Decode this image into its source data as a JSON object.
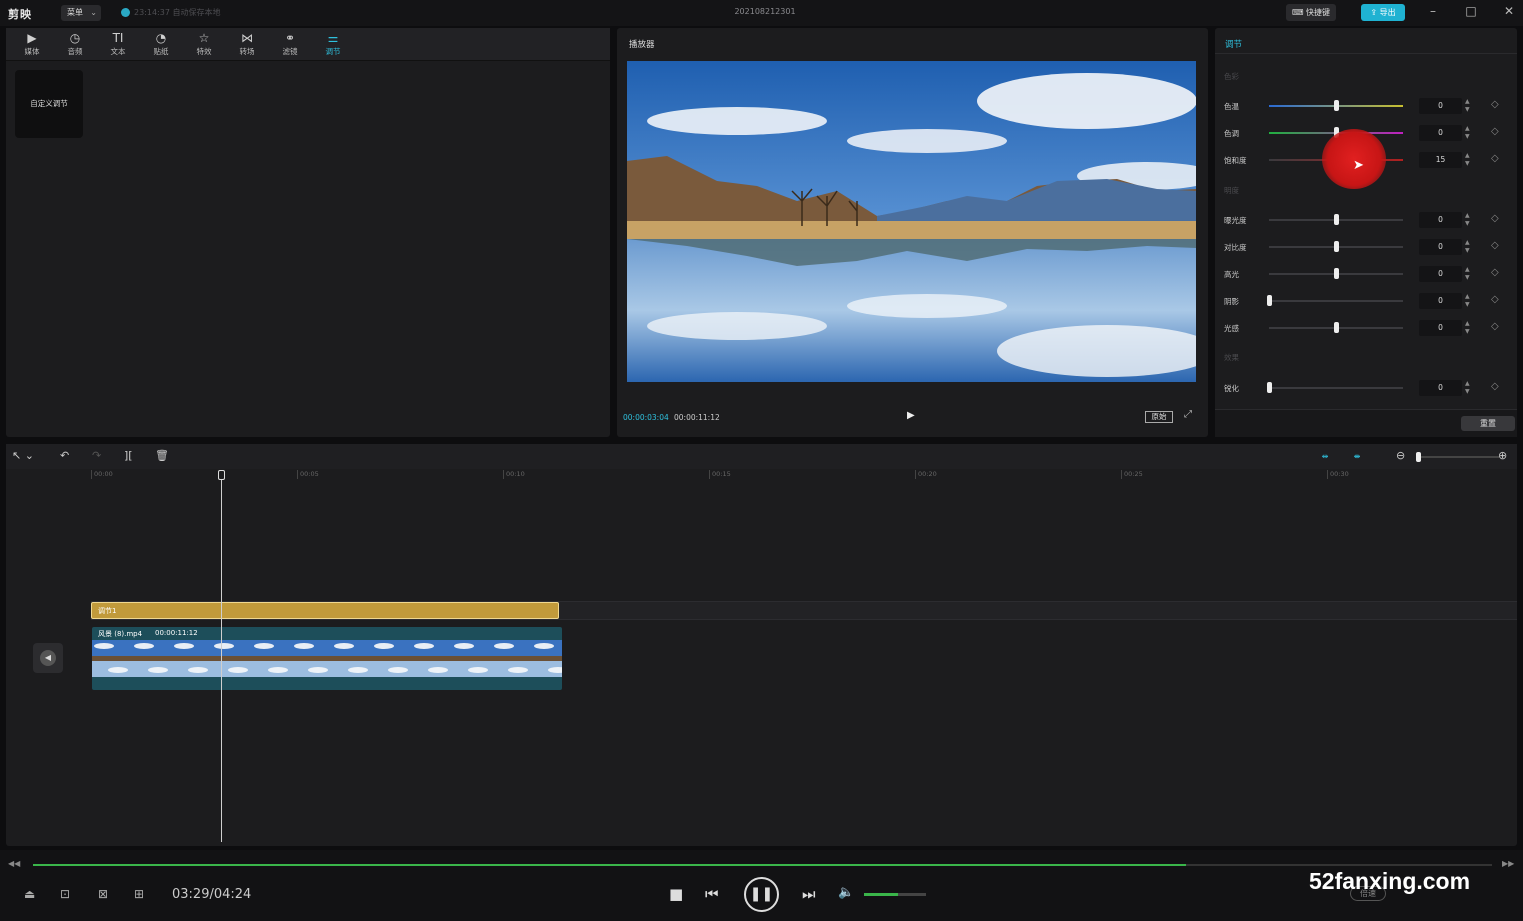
{
  "titlebar": {
    "app_name": "剪映",
    "menu_label": "菜单",
    "autosave_text": "23:14:37 自动保存本地",
    "doc_title": "202108212301",
    "shortcut_label": "快捷键",
    "export_label": "导出"
  },
  "toolbar": {
    "tools": [
      {
        "label": "媒体",
        "icon": "media-icon"
      },
      {
        "label": "音频",
        "icon": "audio-icon"
      },
      {
        "label": "文本",
        "icon": "text-icon"
      },
      {
        "label": "贴纸",
        "icon": "sticker-icon"
      },
      {
        "label": "特效",
        "icon": "effects-icon"
      },
      {
        "label": "转场",
        "icon": "transition-icon"
      },
      {
        "label": "滤镜",
        "icon": "filter-icon"
      },
      {
        "label": "调节",
        "icon": "adjust-icon",
        "active": true
      }
    ]
  },
  "library": {
    "card_label": "自定义调节"
  },
  "player": {
    "title": "播放器",
    "current_time": "00:00:03:04",
    "total_time": "00:00:11:12",
    "original_label": "原始"
  },
  "adjust": {
    "tab_label": "调节",
    "section_color": "色彩",
    "section_light": "明度",
    "section_effect": "效果",
    "reset_label": "重置",
    "color_rows": [
      {
        "name": "色温",
        "value": "0",
        "level": 0.5
      },
      {
        "name": "色调",
        "value": "0",
        "level": 0.5
      },
      {
        "name": "饱和度",
        "value": "15",
        "level": 0.65
      }
    ],
    "light_rows": [
      {
        "name": "曝光度",
        "value": "0",
        "level": 0.5
      },
      {
        "name": "对比度",
        "value": "0",
        "level": 0.5
      },
      {
        "name": "高光",
        "value": "0",
        "level": 0.5
      },
      {
        "name": "阴影",
        "value": "0",
        "level": 0.0
      },
      {
        "name": "光感",
        "value": "0",
        "level": 0.5
      }
    ],
    "effect_rows": [
      {
        "name": "锐化",
        "value": "0",
        "level": 0.0
      }
    ]
  },
  "timeline": {
    "ruler_ticks": [
      "00:00",
      "00:05",
      "00:10",
      "00:15",
      "00:20",
      "00:25",
      "00:30"
    ],
    "adjust_clip_label": "调节1",
    "video_clip_name": "风景 (8).mp4",
    "video_clip_duration": "00:00:11:12"
  },
  "bottom_bar": {
    "time_display": "03:29/04:24",
    "speed_label": "倍速",
    "progress": 0.79,
    "volume": 0.55,
    "watermark": "52fanxing.com"
  },
  "colors": {
    "accent": "#2fc0dd",
    "adjust_clip": "#c19a3b",
    "progress_green": "#3ab54a"
  }
}
